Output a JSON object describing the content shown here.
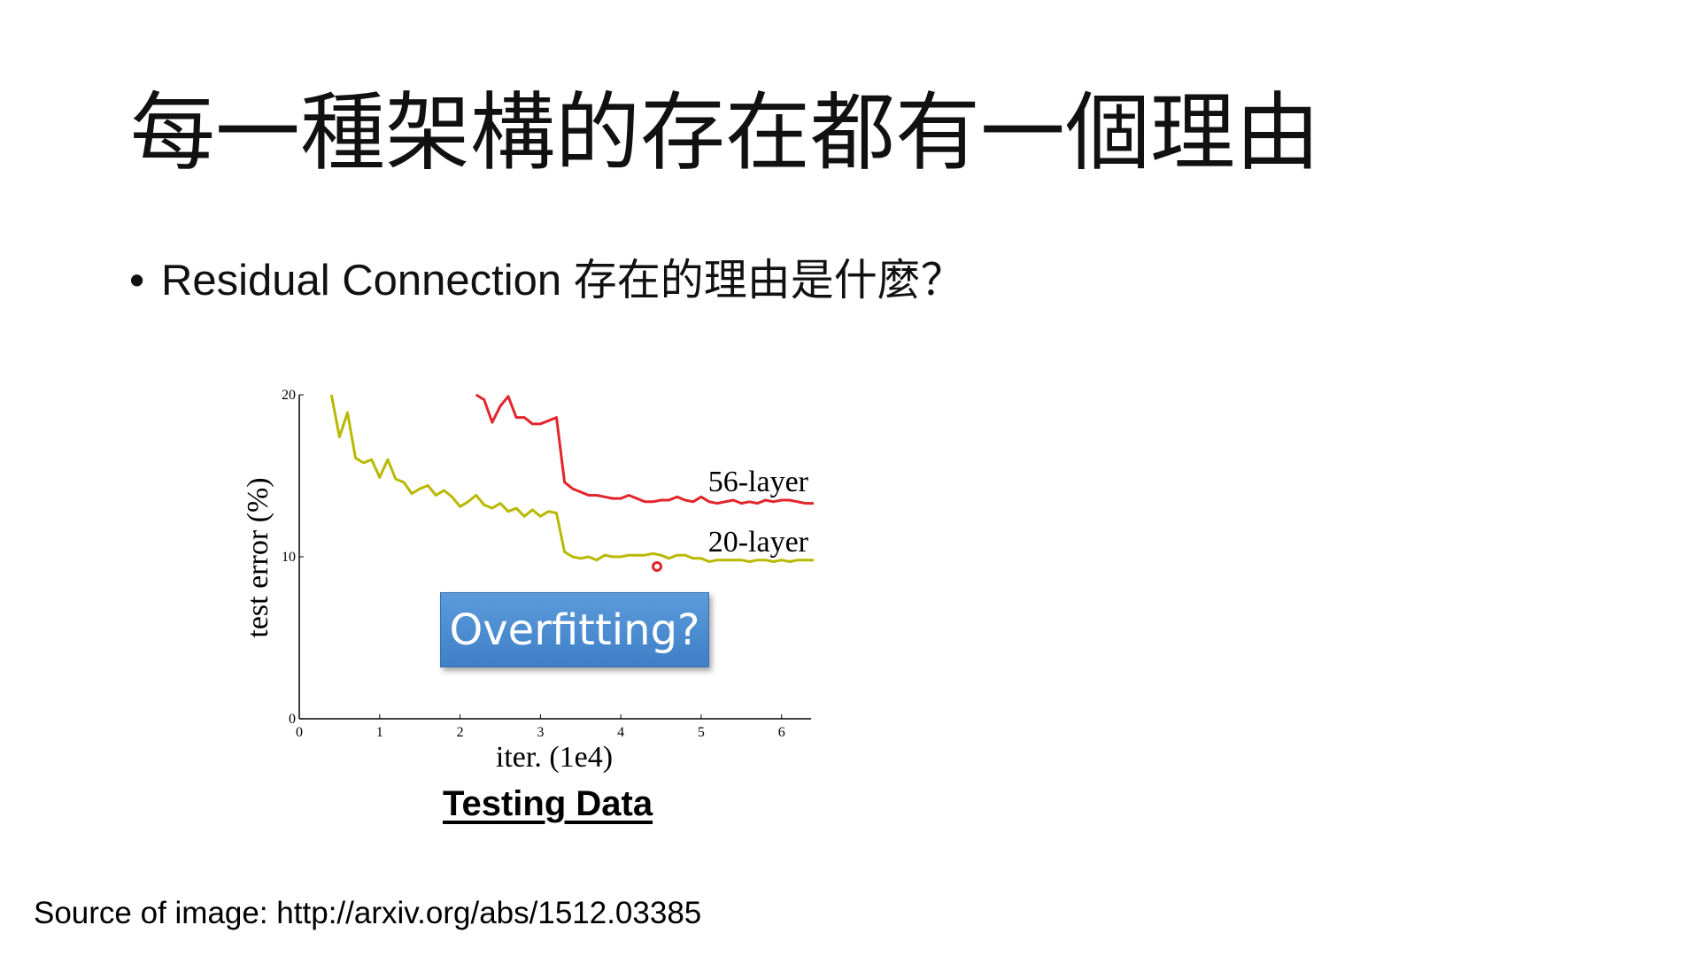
{
  "slide": {
    "title": "每一種架構的存在都有一個理由",
    "bullet_marker": "•",
    "bullet_text": "Residual Connection 存在的理由是什麼？",
    "callout": "Overfitting?",
    "caption": "Testing Data",
    "source": "Source of image: http://arxiv.org/abs/1512.03385"
  },
  "chart_data": {
    "type": "line",
    "xlabel": "iter. (1e4)",
    "ylabel": "test error (%)",
    "xlim": [
      0,
      6.4
    ],
    "ylim": [
      0,
      20
    ],
    "x_ticks": [
      "0",
      "1",
      "2",
      "3",
      "4",
      "5",
      "6"
    ],
    "y_ticks": [
      "0",
      "10",
      "20"
    ],
    "grid": false,
    "series": [
      {
        "name": "56-layer",
        "color": "#e3242b",
        "x": [
          2.2,
          2.3,
          2.4,
          2.5,
          2.6,
          2.7,
          2.8,
          2.9,
          3.0,
          3.1,
          3.2,
          3.3,
          3.4,
          3.5,
          3.6,
          3.7,
          3.8,
          3.9,
          4.0,
          4.1,
          4.2,
          4.3,
          4.4,
          4.5,
          4.6,
          4.7,
          4.8,
          4.9,
          5.0,
          5.1,
          5.2,
          5.3,
          5.4,
          5.5,
          5.6,
          5.7,
          5.8,
          5.9,
          6.0,
          6.1,
          6.2,
          6.3,
          6.4
        ],
        "y": [
          20.0,
          19.7,
          18.3,
          19.3,
          19.9,
          18.6,
          18.6,
          18.2,
          18.2,
          18.4,
          18.6,
          14.6,
          14.2,
          14.0,
          13.8,
          13.8,
          13.7,
          13.6,
          13.6,
          13.8,
          13.6,
          13.4,
          13.4,
          13.5,
          13.5,
          13.7,
          13.5,
          13.4,
          13.7,
          13.4,
          13.3,
          13.4,
          13.5,
          13.3,
          13.4,
          13.3,
          13.5,
          13.4,
          13.5,
          13.5,
          13.4,
          13.3,
          13.3
        ]
      },
      {
        "name": "20-layer",
        "color": "#b8b900",
        "x": [
          0.4,
          0.5,
          0.6,
          0.7,
          0.8,
          0.9,
          1.0,
          1.1,
          1.2,
          1.3,
          1.4,
          1.5,
          1.6,
          1.7,
          1.8,
          1.9,
          2.0,
          2.1,
          2.2,
          2.3,
          2.4,
          2.5,
          2.6,
          2.7,
          2.8,
          2.9,
          3.0,
          3.1,
          3.2,
          3.3,
          3.4,
          3.5,
          3.6,
          3.7,
          3.8,
          3.9,
          4.0,
          4.1,
          4.2,
          4.3,
          4.4,
          4.5,
          4.6,
          4.7,
          4.8,
          4.9,
          5.0,
          5.1,
          5.2,
          5.3,
          5.4,
          5.5,
          5.6,
          5.7,
          5.8,
          5.9,
          6.0,
          6.1,
          6.2,
          6.3,
          6.4
        ],
        "y": [
          20.0,
          17.4,
          18.9,
          16.1,
          15.8,
          16.0,
          14.9,
          16.0,
          14.8,
          14.6,
          13.9,
          14.2,
          14.4,
          13.8,
          14.1,
          13.7,
          13.1,
          13.4,
          13.8,
          13.2,
          13.0,
          13.3,
          12.8,
          13.0,
          12.5,
          12.9,
          12.5,
          12.8,
          12.7,
          10.3,
          10.0,
          9.9,
          10.0,
          9.8,
          10.1,
          10.0,
          10.0,
          10.1,
          10.1,
          10.1,
          10.2,
          10.1,
          9.9,
          10.1,
          10.1,
          9.9,
          9.9,
          9.7,
          9.8,
          9.8,
          9.8,
          9.8,
          9.7,
          9.8,
          9.8,
          9.7,
          9.8,
          9.7,
          9.8,
          9.8,
          9.8
        ]
      }
    ]
  }
}
